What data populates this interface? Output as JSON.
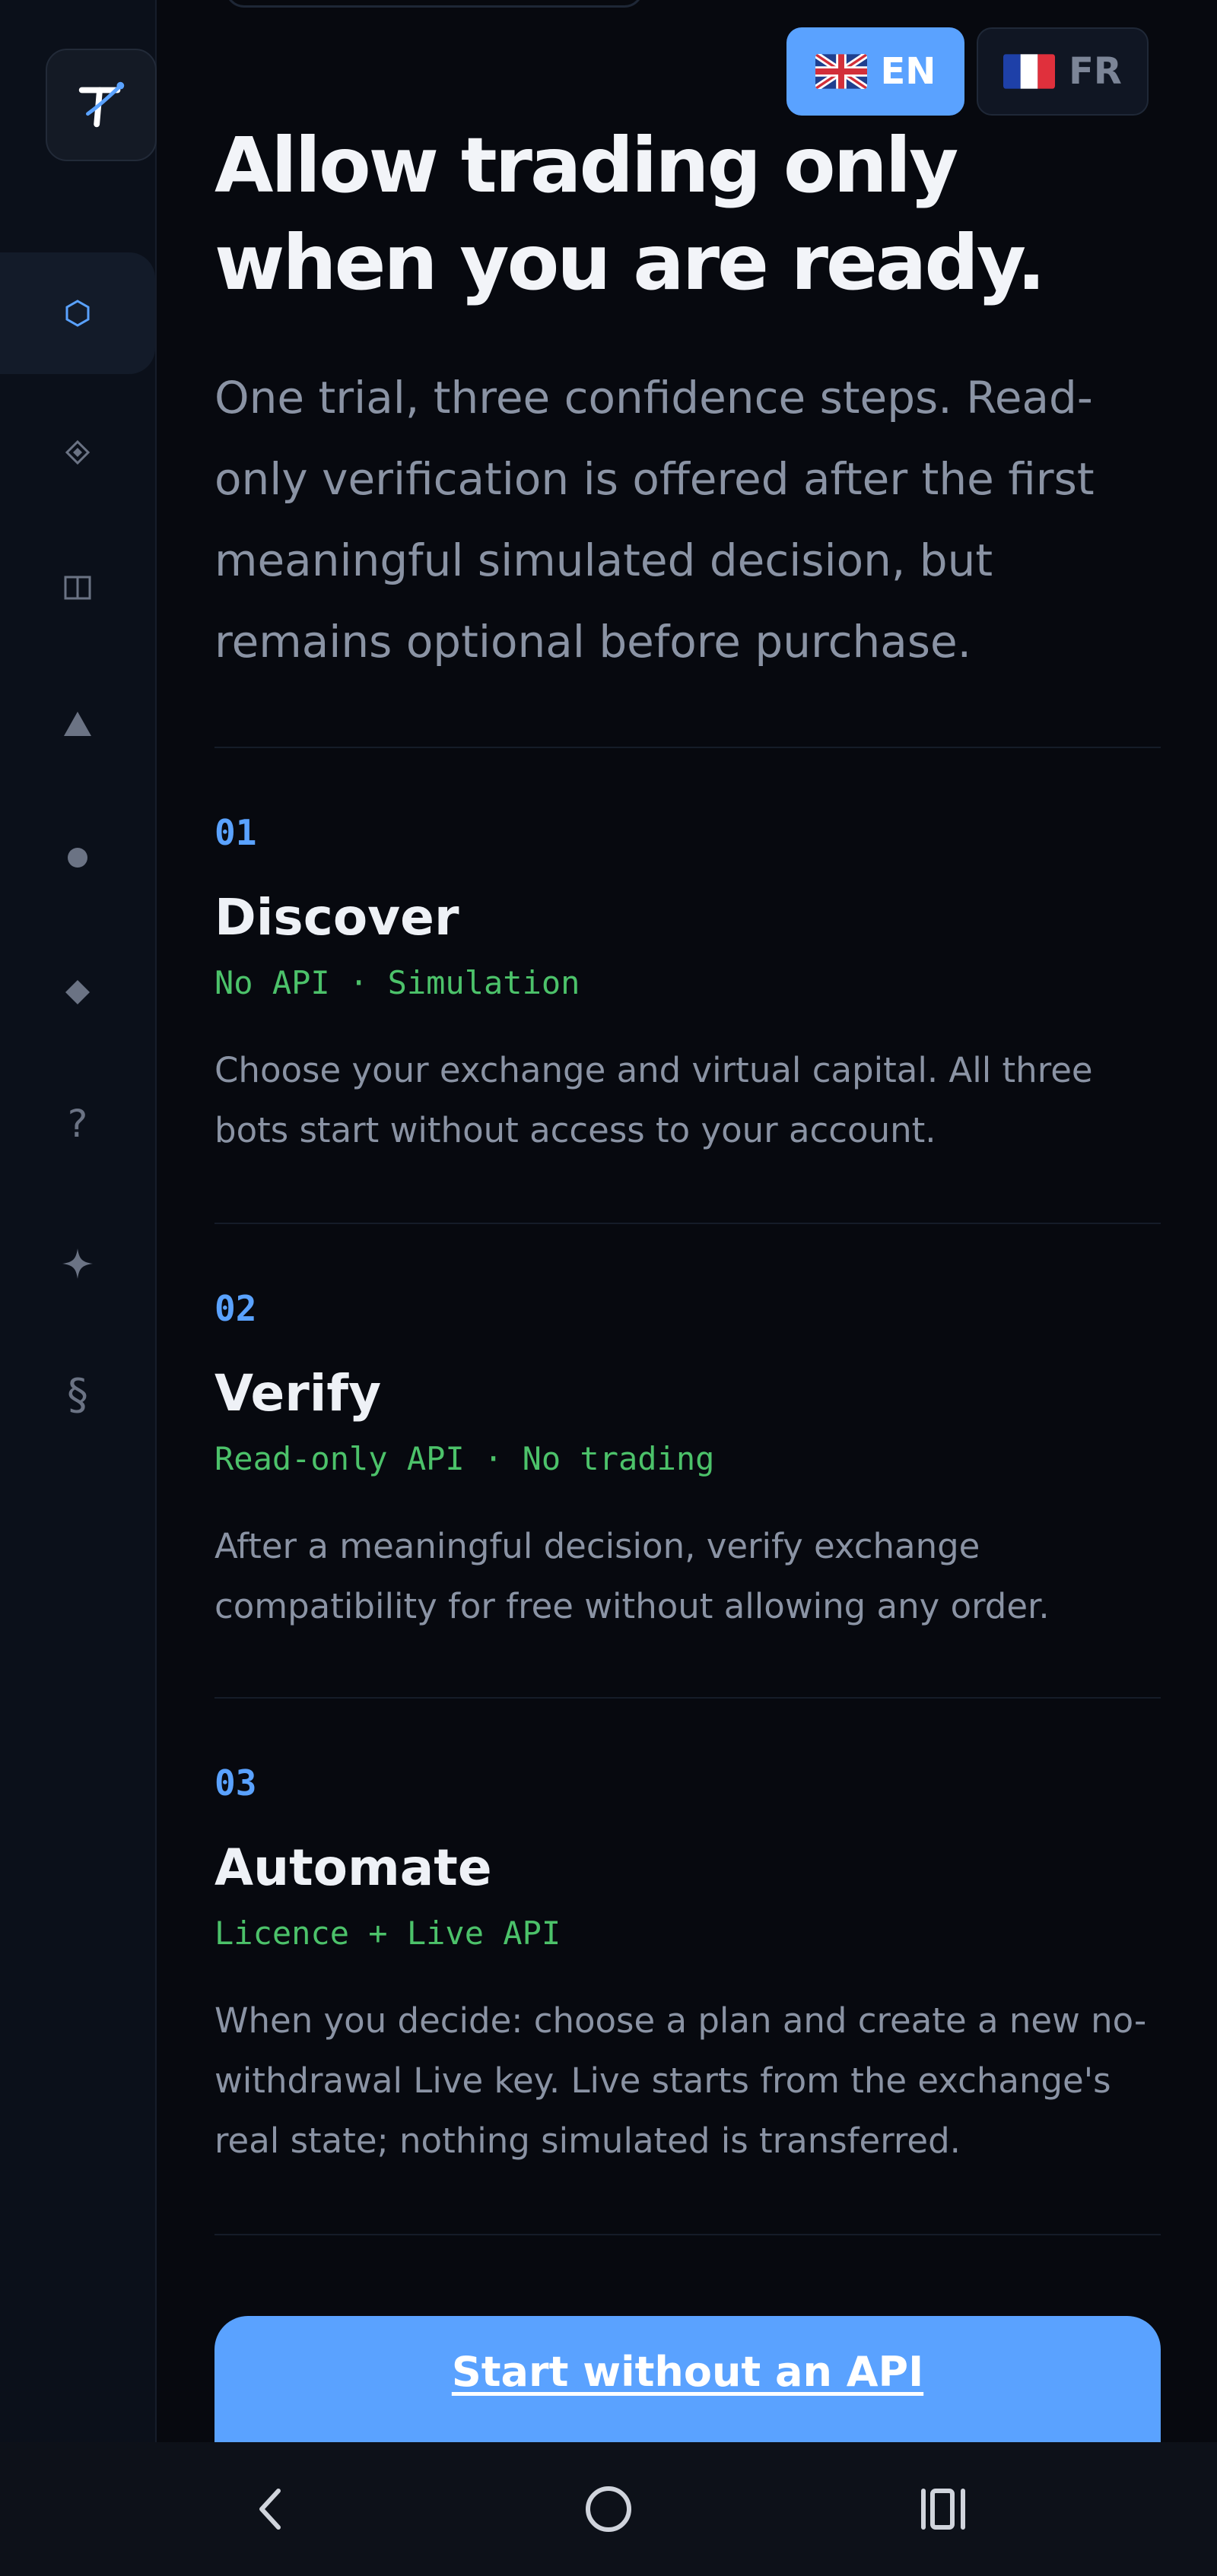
{
  "language": {
    "en_label": "EN",
    "fr_label": "FR",
    "selected": "EN"
  },
  "sidebar": {
    "items": [
      {
        "icon": "hexagon-icon",
        "active": true
      },
      {
        "icon": "diamond-outline-icon",
        "active": false
      },
      {
        "icon": "columns-icon",
        "active": false
      },
      {
        "icon": "triangle-icon",
        "active": false
      },
      {
        "icon": "circle-icon",
        "active": false
      },
      {
        "icon": "diamond-icon",
        "active": false
      },
      {
        "icon": "question-icon",
        "active": false
      },
      {
        "icon": "sparkle-icon",
        "active": false
      },
      {
        "icon": "section-icon",
        "active": false
      }
    ],
    "question_glyph": "?",
    "section_glyph": "§"
  },
  "hero": {
    "title": "Allow trading only when you are ready.",
    "subtitle": "One trial, three confidence steps. Read-only verification is offered after the first meaningful simulated decision, but remains optional before purchase."
  },
  "steps": [
    {
      "number": "01",
      "title": "Discover",
      "tag": "No API · Simulation",
      "description": "Choose your exchange and virtual capital. All three bots start without access to your account."
    },
    {
      "number": "02",
      "title": "Verify",
      "tag": "Read-only API · No trading",
      "description": "After a meaningful decision, verify exchange compatibility for free without allowing any order."
    },
    {
      "number": "03",
      "title": "Automate",
      "tag": "Licence + Live API",
      "description": "When you decide: choose a plan and create a new no-withdrawal Live key. Live starts from the exchange's real state; nothing simulated is transferred."
    }
  ],
  "cta": {
    "label": "Start without an API"
  },
  "colors": {
    "accent": "#5aa2ff",
    "tag_green": "#4cc26a",
    "background": "#07090f",
    "sidebar": "#0b101a"
  }
}
